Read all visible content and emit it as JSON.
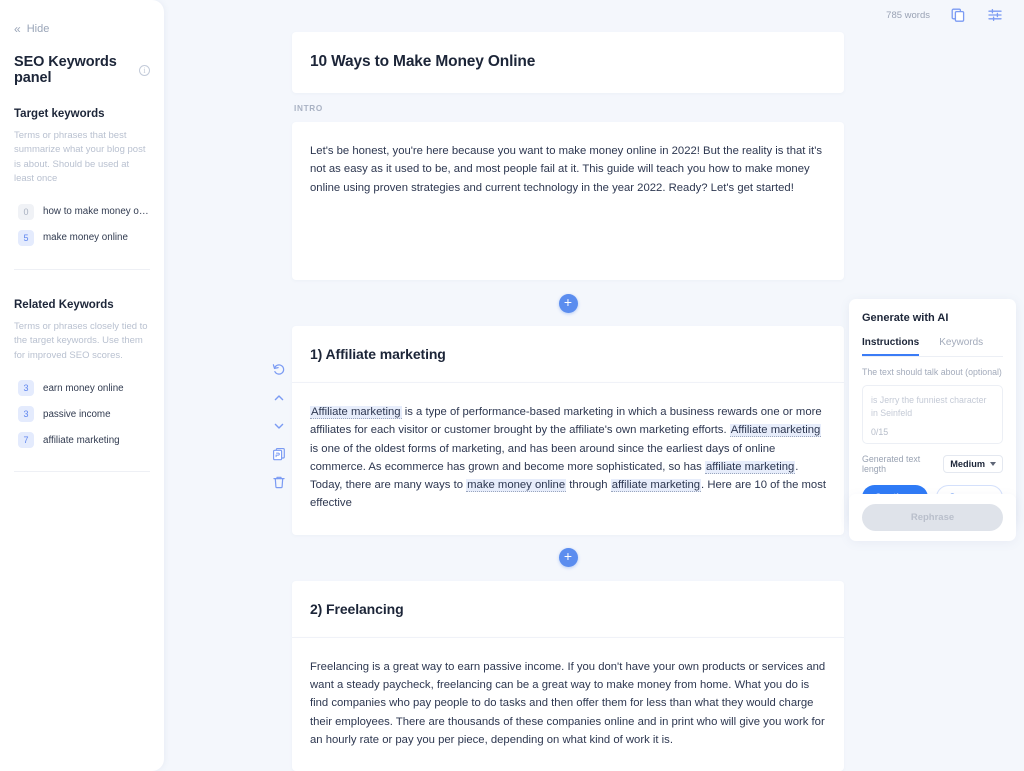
{
  "sidebar": {
    "hide_label": "Hide",
    "hide_icon": "chevrons-left-icon",
    "panel_title": "SEO Keywords panel",
    "info_icon": "info-icon",
    "target": {
      "heading": "Target keywords",
      "description": "Terms or phrases that best summarize what your blog post is about. Should be used at least once",
      "items": [
        {
          "count": "0",
          "label": "how to make money online i...",
          "active": false
        },
        {
          "count": "5",
          "label": "make money online",
          "active": true
        }
      ]
    },
    "related": {
      "heading": "Related Keywords",
      "description": "Terms or phrases closely tied to the target keywords. Use them for improved SEO scores.",
      "items": [
        {
          "count": "3",
          "label": "earn money online",
          "active": true
        },
        {
          "count": "3",
          "label": "passive income",
          "active": true
        },
        {
          "count": "7",
          "label": "affiliate marketing",
          "active": true
        }
      ]
    }
  },
  "topbar": {
    "word_count": "785 words",
    "copy_icon": "copy-icon",
    "settings_icon": "sliders-icon"
  },
  "document": {
    "title": "10 Ways to Make Money Online",
    "intro_label": "INTRO",
    "intro_text": "Let's be honest, you're here because you want to make money online in 2022! But the reality is that it's not as easy as it used to be, and most people fail at it. This guide will teach you how to make money online using proven strategies and current technology in the year 2022. Ready? Let's get started!",
    "section_1": {
      "heading": "1) Affiliate marketing",
      "runs": [
        {
          "text": "Affiliate marketing",
          "highlight": true
        },
        {
          "text": " is a type of performance-based marketing in which a business rewards one or more affiliates for each visitor or customer brought by the affiliate's own marketing efforts. ",
          "highlight": false
        },
        {
          "text": "Affiliate marketing",
          "highlight": true
        },
        {
          "text": " is one of the oldest forms of marketing, and has been around since the earliest days of online commerce. As ecommerce has grown and become more sophisticated, so has ",
          "highlight": false
        },
        {
          "text": "affiliate marketing",
          "highlight": true
        },
        {
          "text": ". Today, there are many ways to ",
          "highlight": false
        },
        {
          "text": "make money online",
          "highlight": true
        },
        {
          "text": " through ",
          "highlight": false
        },
        {
          "text": "affiliate marketing",
          "highlight": true
        },
        {
          "text": ". Here are 10 of the most effective",
          "highlight": false
        }
      ]
    },
    "section_2": {
      "heading": "2) Freelancing",
      "text": "Freelancing is a great way to earn passive income. If you don't have your own products or services and want a steady paycheck, freelancing can be a great way to make money from home. What you do is find companies who pay people to do tasks and then offer them for less than what they would charge their employees. There are thousands of these companies online and in print who will give you work for an hourly rate or pay you per piece, depending on what kind of work it is."
    },
    "add_block_label": "+"
  },
  "block_tools": [
    {
      "icon": "undo-icon",
      "name": "regenerate-button"
    },
    {
      "icon": "chevron-up-icon",
      "name": "move-up-button"
    },
    {
      "icon": "chevron-down-icon",
      "name": "move-down-button"
    },
    {
      "icon": "duplicate-icon",
      "name": "duplicate-button"
    },
    {
      "icon": "trash-icon",
      "name": "delete-button"
    }
  ],
  "ai_panel": {
    "title": "Generate with AI",
    "tabs": [
      {
        "label": "Instructions",
        "active": true
      },
      {
        "label": "Keywords",
        "active": false
      }
    ],
    "field_label": "The text should talk about (optional)",
    "input_placeholder": "is Jerry the funniest character in Seinfeld",
    "input_value": "",
    "counter": "0/15",
    "length_label": "Generated text length",
    "length_value": "Medium",
    "continue_label": "Continue",
    "start_over_label": "Start over",
    "rephrase_label": "Rephrase"
  },
  "colors": {
    "accent": "#2f7bf6",
    "background": "#f4f7fc",
    "highlight": "#e7edfb",
    "icon_blue": "#7b9bf3"
  }
}
